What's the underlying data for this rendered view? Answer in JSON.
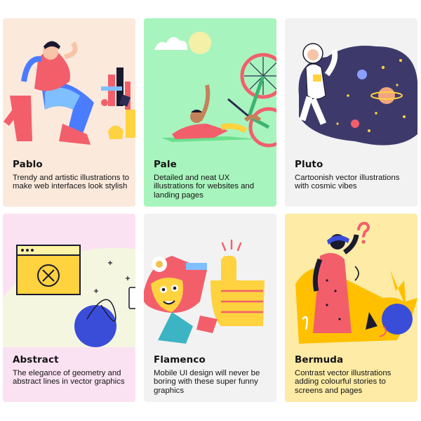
{
  "cards": [
    {
      "title": "Pablo",
      "description": "Trendy and artistic illustrations to make web interfaces look stylish",
      "bg": "#fbe9dc"
    },
    {
      "title": "Pale",
      "description": "Detailed and neat UX illustrations for websites and landing pages",
      "bg": "#a8f4be"
    },
    {
      "title": "Pluto",
      "description": "Cartoonish vector illustrations with cosmic vibes",
      "bg": "#f2f2f2"
    },
    {
      "title": "Abstract",
      "description": "The elegance of geometry and abstract lines in vector graphics",
      "bg": "#fbe2f3"
    },
    {
      "title": "Flamenco",
      "description": "Mobile UI design will never be boring with these super funny graphics",
      "bg": "#f2f2f2"
    },
    {
      "title": "Bermuda",
      "description": "Contrast vector illustrations adding colourful stories to screens and pages",
      "bg": "#fdeba6"
    }
  ]
}
